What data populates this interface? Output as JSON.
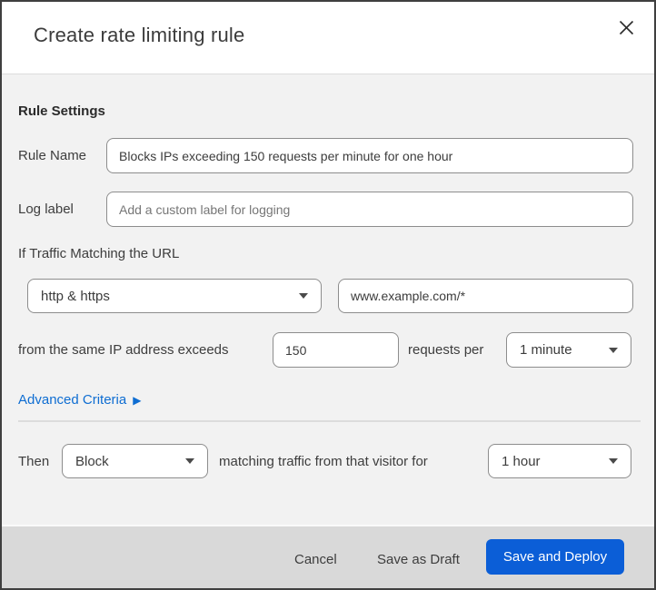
{
  "header": {
    "title": "Create rate limiting rule"
  },
  "rule_settings": {
    "heading": "Rule Settings",
    "rule_name_label": "Rule Name",
    "rule_name_value": "Blocks IPs exceeding 150 requests per minute for one hour",
    "log_label": "Log label",
    "log_placeholder": "Add a custom label for logging"
  },
  "traffic": {
    "heading": "If Traffic Matching the URL",
    "scheme_value": "http & https",
    "url_value": "www.example.com/*",
    "exceeds_text": "from the same IP address exceeds",
    "count_value": "150",
    "per_text": "requests per",
    "period_value": "1 minute",
    "advanced_label": "Advanced Criteria",
    "advanced_arrow": "▶"
  },
  "action": {
    "then_text": "Then",
    "action_value": "Block",
    "matching_text": "matching traffic from that visitor for",
    "duration_value": "1 hour"
  },
  "footer": {
    "cancel_label": "Cancel",
    "draft_label": "Save as Draft",
    "deploy_label": "Save and Deploy"
  },
  "colors": {
    "primary_button": "#0b5ed7",
    "link_blue": "#0e6dd2",
    "body_bg": "#f2f2f2",
    "footer_bg": "#d9d9d9",
    "top_accent": "#1c2531"
  }
}
